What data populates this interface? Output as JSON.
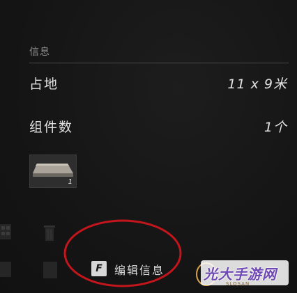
{
  "info": {
    "section_title": "信息",
    "rows": [
      {
        "label": "占地",
        "value": "11 x 9米"
      },
      {
        "label": "组件数",
        "value": "1个"
      }
    ]
  },
  "component_thumbnail": {
    "count": "1"
  },
  "actions": {
    "edit_key": "F",
    "edit_label": "编辑信息"
  },
  "watermark": {
    "text": "光大手游网",
    "sub": "SLOSAN"
  },
  "colors": {
    "annotation_circle": "#c3161c",
    "watermark_text": "#6f49b3",
    "watermark_ring": "#d8a24a"
  }
}
